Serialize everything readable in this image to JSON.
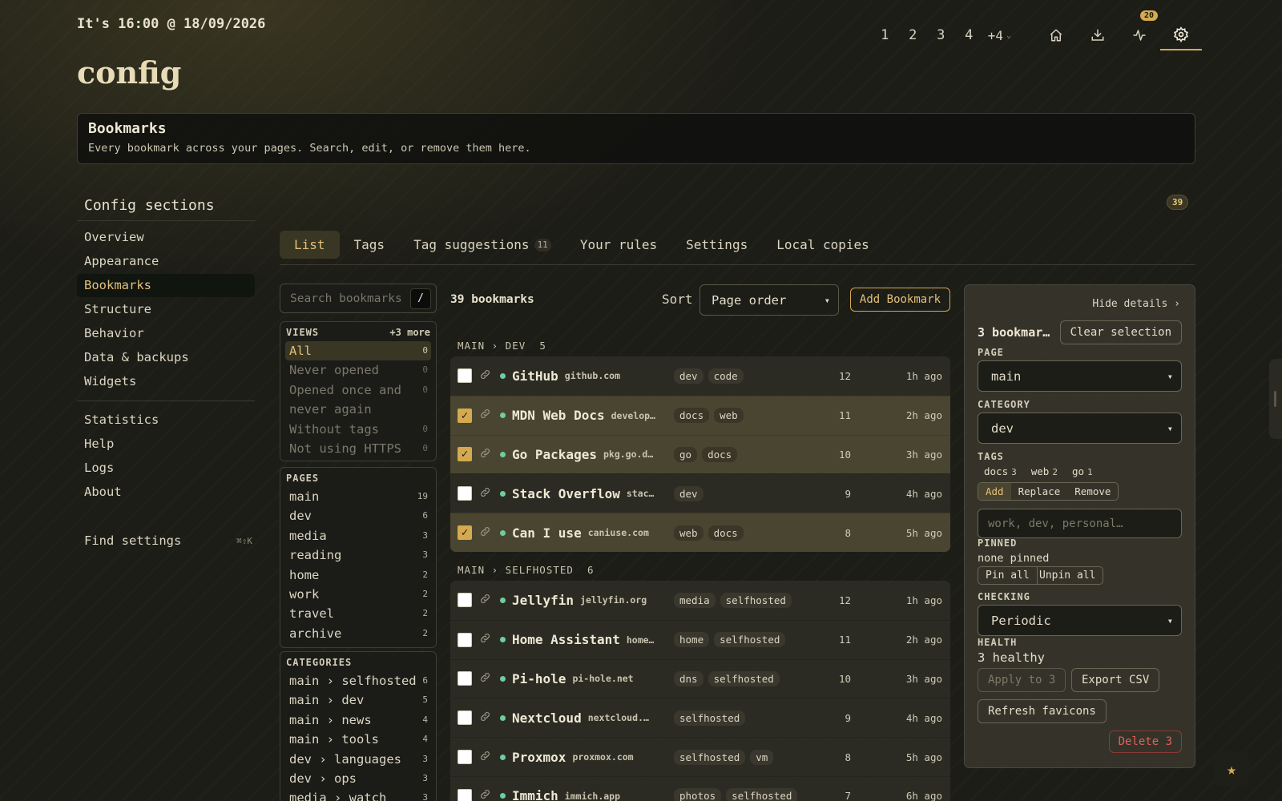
{
  "header": {
    "clock": "It's 16:00 @ 18/09/2026",
    "title": "config",
    "nav_pages": [
      "1",
      "2",
      "3",
      "4"
    ],
    "nav_more": "+4",
    "notifications_badge": "20"
  },
  "section_card": {
    "title": "Bookmarks",
    "subtitle": "Every bookmark across your pages. Search, edit, or remove them here."
  },
  "sidebar": {
    "title": "Config sections",
    "items": [
      "Overview",
      "Appearance",
      "Bookmarks",
      "Structure",
      "Behavior",
      "Data & backups",
      "Widgets"
    ],
    "items2": [
      "Statistics",
      "Help",
      "Logs",
      "About"
    ],
    "active": "Bookmarks",
    "find_label": "Find settings",
    "find_shortcut": "⌘⇧K"
  },
  "total_badge": "39",
  "tabs": [
    {
      "label": "List",
      "count": ""
    },
    {
      "label": "Tags",
      "count": ""
    },
    {
      "label": "Tag suggestions",
      "count": "11"
    },
    {
      "label": "Your rules",
      "count": ""
    },
    {
      "label": "Settings",
      "count": ""
    },
    {
      "label": "Local copies",
      "count": ""
    }
  ],
  "filters": {
    "search_placeholder": "Search bookmarks",
    "search_key": "/",
    "views_title": "VIEWS",
    "views_more": "+3 more",
    "views": [
      {
        "label": "All",
        "count": "0"
      },
      {
        "label": "Never opened",
        "count": "0"
      },
      {
        "label": "Opened once and never again",
        "count": "0"
      },
      {
        "label": "Without tags",
        "count": "0"
      },
      {
        "label": "Not using HTTPS",
        "count": "0"
      }
    ],
    "pages_title": "PAGES",
    "pages": [
      {
        "label": "main",
        "count": "19"
      },
      {
        "label": "dev",
        "count": "6"
      },
      {
        "label": "media",
        "count": "3"
      },
      {
        "label": "reading",
        "count": "3"
      },
      {
        "label": "home",
        "count": "2"
      },
      {
        "label": "work",
        "count": "2"
      },
      {
        "label": "travel",
        "count": "2"
      },
      {
        "label": "archive",
        "count": "2"
      }
    ],
    "categories_title": "CATEGORIES",
    "categories": [
      {
        "label": "main › selfhosted",
        "count": "6"
      },
      {
        "label": "main › dev",
        "count": "5"
      },
      {
        "label": "main › news",
        "count": "4"
      },
      {
        "label": "main › tools",
        "count": "4"
      },
      {
        "label": "dev › languages",
        "count": "3"
      },
      {
        "label": "dev › ops",
        "count": "3"
      },
      {
        "label": "media › watch",
        "count": "3"
      }
    ]
  },
  "list": {
    "count_label": "39 bookmarks",
    "sort_label": "Sort",
    "sort_value": "Page order",
    "add_label": "Add Bookmark",
    "groups": [
      {
        "label": "MAIN › DEV",
        "count": "5",
        "rows": [
          {
            "name": "GitHub",
            "domain": "github.com",
            "tags": [
              "dev",
              "code"
            ],
            "visits": "12",
            "ago": "1h ago",
            "selected": false
          },
          {
            "name": "MDN Web Docs",
            "domain": "develop…",
            "tags": [
              "docs",
              "web"
            ],
            "visits": "11",
            "ago": "2h ago",
            "selected": true
          },
          {
            "name": "Go Packages",
            "domain": "pkg.go.d…",
            "tags": [
              "go",
              "docs"
            ],
            "visits": "10",
            "ago": "3h ago",
            "selected": true
          },
          {
            "name": "Stack Overflow",
            "domain": "stac…",
            "tags": [
              "dev"
            ],
            "visits": "9",
            "ago": "4h ago",
            "selected": false
          },
          {
            "name": "Can I use",
            "domain": "caniuse.com",
            "tags": [
              "web",
              "docs"
            ],
            "visits": "8",
            "ago": "5h ago",
            "selected": true
          }
        ]
      },
      {
        "label": "MAIN › SELFHOSTED",
        "count": "6",
        "rows": [
          {
            "name": "Jellyfin",
            "domain": "jellyfin.org",
            "tags": [
              "media",
              "selfhosted"
            ],
            "visits": "12",
            "ago": "1h ago",
            "selected": false
          },
          {
            "name": "Home Assistant",
            "domain": "home…",
            "tags": [
              "home",
              "selfhosted"
            ],
            "visits": "11",
            "ago": "2h ago",
            "selected": false
          },
          {
            "name": "Pi-hole",
            "domain": "pi-hole.net",
            "tags": [
              "dns",
              "selfhosted"
            ],
            "visits": "10",
            "ago": "3h ago",
            "selected": false
          },
          {
            "name": "Nextcloud",
            "domain": "nextcloud.…",
            "tags": [
              "selfhosted"
            ],
            "visits": "9",
            "ago": "4h ago",
            "selected": false
          },
          {
            "name": "Proxmox",
            "domain": "proxmox.com",
            "tags": [
              "selfhosted",
              "vm"
            ],
            "visits": "8",
            "ago": "5h ago",
            "selected": false
          },
          {
            "name": "Immich",
            "domain": "immich.app",
            "tags": [
              "photos",
              "selfhosted"
            ],
            "visits": "7",
            "ago": "6h ago",
            "selected": false
          }
        ]
      }
    ]
  },
  "details": {
    "hide_label": "Hide details ›",
    "selection_label": "3 bookmar…",
    "clear_label": "Clear selection",
    "page_label": "PAGE",
    "page_value": "main",
    "category_label": "CATEGORY",
    "category_value": "dev",
    "tags_label": "TAGS",
    "tag_counts": [
      {
        "tag": "docs",
        "count": "3"
      },
      {
        "tag": "web",
        "count": "2"
      },
      {
        "tag": "go",
        "count": "1"
      }
    ],
    "tag_modes": [
      "Add",
      "Replace",
      "Remove"
    ],
    "tag_input_placeholder": "work, dev, personal…",
    "pinned_label": "PINNED",
    "pinned_value": "none pinned",
    "pin_all": "Pin all",
    "unpin_all": "Unpin all",
    "checking_label": "CHECKING",
    "checking_value": "Periodic",
    "health_label": "HEALTH",
    "health_value": "3 healthy",
    "apply_label": "Apply to 3",
    "export_label": "Export CSV",
    "refresh_label": "Refresh favicons",
    "delete_label": "Delete 3"
  },
  "colors": {
    "accent": "#d4a94f",
    "status_ok": "#6ccf9c",
    "danger": "#e0605a"
  }
}
